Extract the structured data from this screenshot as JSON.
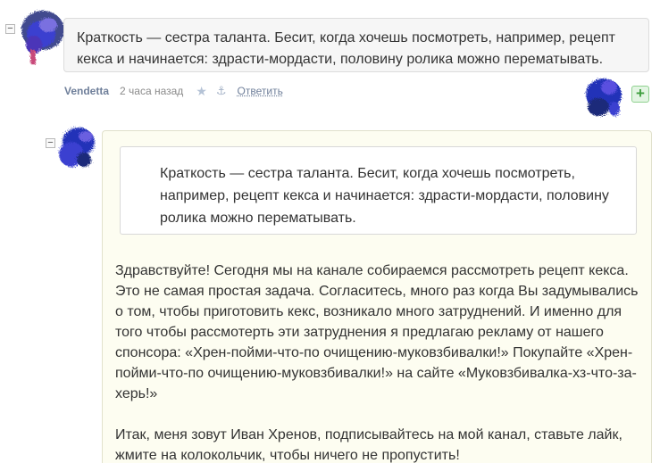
{
  "comment": {
    "text": "Краткость — сестра таланта. Бесит, когда хочешь посмотреть, например, рецепт кекса и начинается: здрасти-мордасти, половину ролика можно перематывать.",
    "author": "Vendetta",
    "time": "2 часа назад",
    "reply_label": "Ответить",
    "collapse_symbol": "−",
    "star_symbol": "★",
    "anchor_symbol": "⚓",
    "add_symbol": "+"
  },
  "reply": {
    "collapse_symbol": "−",
    "quote": "Краткость — сестра таланта. Бесит, когда хочешь посмотреть, например, рецепт кекса и начинается: здрасти-мордасти, половину ролика можно перематывать.",
    "paragraphs": [
      "Здравствуйте! Сегодня мы на канале собираемся рассмотреть рецепт кекса. Это не самая простая задача. Согласитесь, много раз когда Вы задумывались о том, чтобы приготовить кекс, возникало много затруднений. И именно для того чтобы рассмотерть эти затруднения я предлагаю рекламу от нашего спонсора: «Хрен-пойми-что-по очищению-муковзбивалки!» Покупайте «Хрен-пойми-что-по очищению-муковзбивалки!» на сайте «Муковзбивалка-хз-что-за-херь!»",
      "Итак, меня зовут Иван Хренов, подписывайтесь на мой канал, ставьте лайк, жмите на колокольчик, чтобы ничего не пропустить!"
    ]
  },
  "colors": {
    "avatar_blue": "#3a3fd0",
    "avatar_navy": "#1c2a7a",
    "avatar_pink": "#c84a7a",
    "reply_background": "#fdfdf1",
    "accent_green": "#3f9f3f"
  },
  "icons": {
    "avatar_top": "avatar-icon",
    "avatar_right": "avatar-icon",
    "avatar_reply": "avatar-icon",
    "star": "star-icon",
    "anchor": "anchor-icon",
    "plus": "plus-icon",
    "collapse": "minus-icon"
  }
}
